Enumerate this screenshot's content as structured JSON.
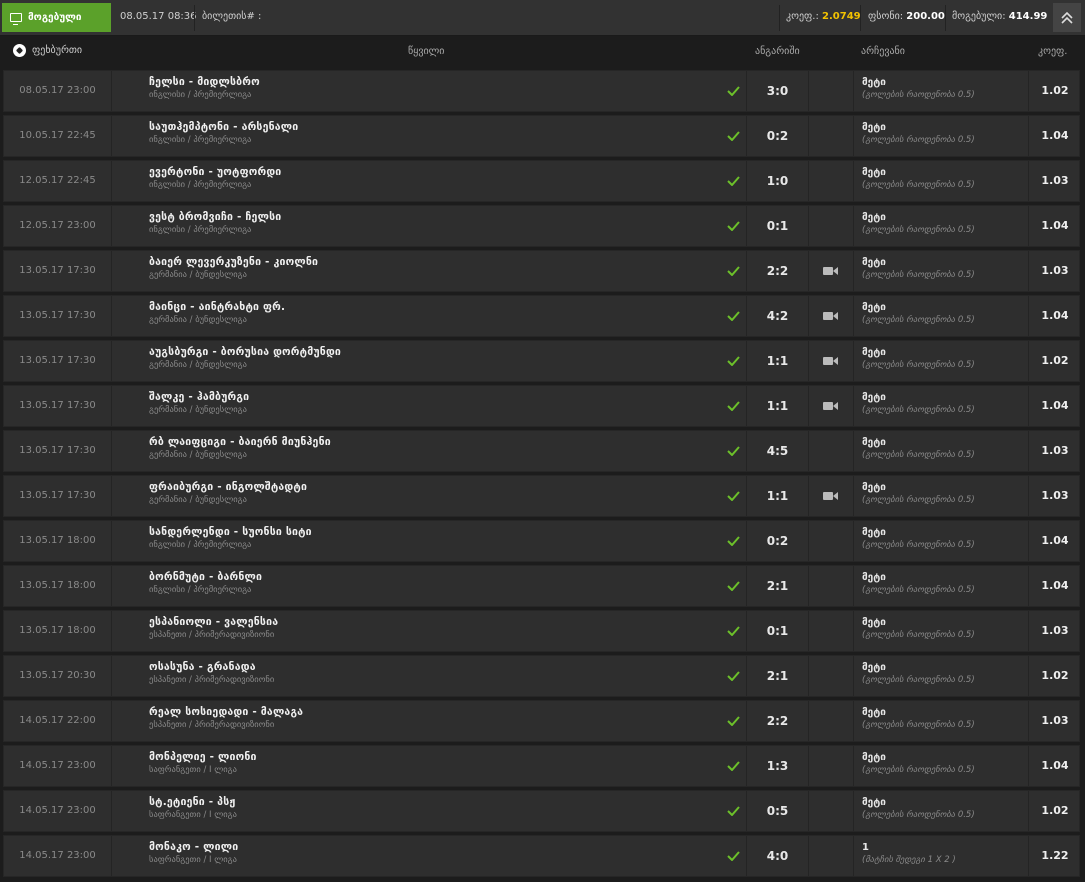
{
  "topbar": {
    "won_label": "მოგებული",
    "date": "08.05.17 08:36",
    "ticket_label": "ბილეთის# :",
    "odds_label": "კოეფ.:",
    "odds_value": "2.0749",
    "stake_label": "ფსონი:",
    "stake_value": "200.00",
    "win_label": "მოგებული:",
    "win_value": "414.99"
  },
  "header": {
    "sport": "ფეხბურთი",
    "pair": "წყვილი",
    "score": "ანგარიში",
    "choice": "არჩევანი",
    "odds": "კოეფ."
  },
  "rows": [
    {
      "date": "08.05.17 23:00",
      "match": "ჩელსი - მიდლსბრო",
      "league": "ინგლისი / პრემიერლიგა",
      "score": "3:0",
      "video": false,
      "pick": "მეტი",
      "sub": "(გოლების რაოდენობა 0.5)",
      "odd": "1.02"
    },
    {
      "date": "10.05.17 22:45",
      "match": "საუთჰემპტონი - არსენალი",
      "league": "ინგლისი / პრემიერლიგა",
      "score": "0:2",
      "video": false,
      "pick": "მეტი",
      "sub": "(გოლების რაოდენობა 0.5)",
      "odd": "1.04"
    },
    {
      "date": "12.05.17 22:45",
      "match": "ევერტონი - უოტფორდი",
      "league": "ინგლისი / პრემიერლიგა",
      "score": "1:0",
      "video": false,
      "pick": "მეტი",
      "sub": "(გოლების რაოდენობა 0.5)",
      "odd": "1.03"
    },
    {
      "date": "12.05.17 23:00",
      "match": "ვესტ ბრომვიჩი - ჩელსი",
      "league": "ინგლისი / პრემიერლიგა",
      "score": "0:1",
      "video": false,
      "pick": "მეტი",
      "sub": "(გოლების რაოდენობა 0.5)",
      "odd": "1.04"
    },
    {
      "date": "13.05.17 17:30",
      "match": "ბაიერ ლევერკუზენი - კიოლნი",
      "league": "გერმანია / ბუნდესლიგა",
      "score": "2:2",
      "video": true,
      "pick": "მეტი",
      "sub": "(გოლების რაოდენობა 0.5)",
      "odd": "1.03"
    },
    {
      "date": "13.05.17 17:30",
      "match": "მაინცი - აინტრახტი ფრ.",
      "league": "გერმანია / ბუნდესლიგა",
      "score": "4:2",
      "video": true,
      "pick": "მეტი",
      "sub": "(გოლების რაოდენობა 0.5)",
      "odd": "1.04"
    },
    {
      "date": "13.05.17 17:30",
      "match": "აუგსბურგი - ბორუსია დორტმუნდი",
      "league": "გერმანია / ბუნდესლიგა",
      "score": "1:1",
      "video": true,
      "pick": "მეტი",
      "sub": "(გოლების რაოდენობა 0.5)",
      "odd": "1.02"
    },
    {
      "date": "13.05.17 17:30",
      "match": "შალკე - ჰამბურგი",
      "league": "გერმანია / ბუნდესლიგა",
      "score": "1:1",
      "video": true,
      "pick": "მეტი",
      "sub": "(გოლების რაოდენობა 0.5)",
      "odd": "1.04"
    },
    {
      "date": "13.05.17 17:30",
      "match": "რბ ლაიფციგი - ბაიერნ მიუნჰენი",
      "league": "გერმანია / ბუნდესლიგა",
      "score": "4:5",
      "video": false,
      "pick": "მეტი",
      "sub": "(გოლების რაოდენობა 0.5)",
      "odd": "1.03"
    },
    {
      "date": "13.05.17 17:30",
      "match": "ფრაიბურგი - ინგოლშტადტი",
      "league": "გერმანია / ბუნდესლიგა",
      "score": "1:1",
      "video": true,
      "pick": "მეტი",
      "sub": "(გოლების რაოდენობა 0.5)",
      "odd": "1.03"
    },
    {
      "date": "13.05.17 18:00",
      "match": "სანდერლენდი - სუონსი სიტი",
      "league": "ინგლისი / პრემიერლიგა",
      "score": "0:2",
      "video": false,
      "pick": "მეტი",
      "sub": "(გოლების რაოდენობა 0.5)",
      "odd": "1.04"
    },
    {
      "date": "13.05.17 18:00",
      "match": "ბორნმუტი - ბარნლი",
      "league": "ინგლისი / პრემიერლიგა",
      "score": "2:1",
      "video": false,
      "pick": "მეტი",
      "sub": "(გოლების რაოდენობა 0.5)",
      "odd": "1.04"
    },
    {
      "date": "13.05.17 18:00",
      "match": "ესპანიოლი - ვალენსია",
      "league": "ესპანეთი / პრიმერადივიზიონი",
      "score": "0:1",
      "video": false,
      "pick": "მეტი",
      "sub": "(გოლების რაოდენობა 0.5)",
      "odd": "1.03"
    },
    {
      "date": "13.05.17 20:30",
      "match": "ოსასუნა - გრანადა",
      "league": "ესპანეთი / პრიმერადივიზიონი",
      "score": "2:1",
      "video": false,
      "pick": "მეტი",
      "sub": "(გოლების რაოდენობა 0.5)",
      "odd": "1.02"
    },
    {
      "date": "14.05.17 22:00",
      "match": "რეალ სოსიედადი - მალაგა",
      "league": "ესპანეთი / პრიმერადივიზიონი",
      "score": "2:2",
      "video": false,
      "pick": "მეტი",
      "sub": "(გოლების რაოდენობა 0.5)",
      "odd": "1.03"
    },
    {
      "date": "14.05.17 23:00",
      "match": "მონპელიე - ლიონი",
      "league": "საფრანგეთი / I ლიგა",
      "score": "1:3",
      "video": false,
      "pick": "მეტი",
      "sub": "(გოლების რაოდენობა 0.5)",
      "odd": "1.04"
    },
    {
      "date": "14.05.17 23:00",
      "match": "სტ.ეტიენი - პსჟ",
      "league": "საფრანგეთი / I ლიგა",
      "score": "0:5",
      "video": false,
      "pick": "მეტი",
      "sub": "(გოლების რაოდენობა 0.5)",
      "odd": "1.02"
    },
    {
      "date": "14.05.17 23:00",
      "match": "მონაკო - ლილი",
      "league": "საფრანგეთი / I ლიგა",
      "score": "4:0",
      "video": false,
      "pick": "1",
      "sub": "(მატჩის შედეგი 1 X 2 )",
      "odd": "1.22"
    }
  ],
  "icons": {
    "monitor": "monitor-icon",
    "ball": "soccer-ball-icon",
    "check": "checkmark-icon",
    "video": "video-camera-icon",
    "collapse": "double-chevron-up-icon"
  },
  "colors": {
    "accent_green": "#5ba12a",
    "check_green": "#6cc02a",
    "odds_yellow": "#f2c200"
  }
}
